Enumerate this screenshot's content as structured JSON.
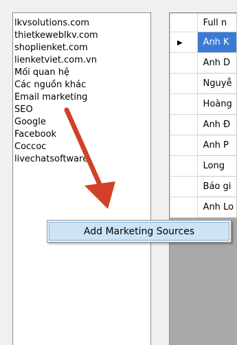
{
  "sources_list": {
    "items": [
      "lkvsolutions.com",
      "thietkeweblkv.com",
      "shoplienket.com",
      "lienketviet.com.vn",
      "Mối quan hệ",
      "Các nguồn khác",
      "Email marketing",
      "SEO",
      "Google",
      "Facebook",
      "Coccoc",
      "livechatsoftware"
    ]
  },
  "grid": {
    "column_header": "Full n",
    "current_row_marker": "▶",
    "rows": [
      "Anh K",
      "Anh D",
      "Nguyễ",
      "Hoàng",
      "Anh Đ",
      "Anh P",
      "Long",
      "Báo gi",
      "Anh Lo"
    ]
  },
  "context_menu": {
    "item_label": "Add Marketing Sources"
  },
  "annotation": {
    "arrow_color": "#d1412a"
  }
}
